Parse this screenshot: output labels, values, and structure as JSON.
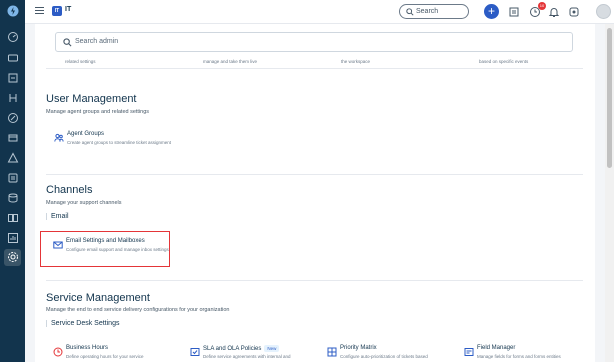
{
  "header": {
    "workspace_badge": "IT",
    "workspace_name": "IT",
    "search_label": "Search",
    "notifications_count": "10"
  },
  "admin_search": {
    "placeholder": "Search admin"
  },
  "prev_row_texts": [
    "related settings",
    "manage and take them live",
    "the workspace",
    "based on specific events"
  ],
  "user_management": {
    "title": "User Management",
    "description": "Manage agent groups and related settings",
    "cards": [
      {
        "title": "Agent Groups",
        "description": "Create agent groups to streamline ticket assignment",
        "icon": "agent-groups-icon"
      }
    ]
  },
  "channels": {
    "title": "Channels",
    "description": "Manage your support channels",
    "subsection": "Email",
    "cards": [
      {
        "title": "Email Settings and Mailboxes",
        "description": "Configure email support and manage inbox settings",
        "icon": "mail-icon"
      }
    ]
  },
  "service_management": {
    "title": "Service Management",
    "description": "Manage the end to end service delivery configurations for your organization",
    "subsection": "Service Desk Settings",
    "cards": [
      {
        "title": "Business Hours",
        "description": "Define operating hours for your service",
        "icon": "clock-icon"
      },
      {
        "title": "SLA and OLA Policies",
        "badge": "New",
        "description": "Define service agreements with internal and",
        "icon": "sla-icon"
      },
      {
        "title": "Priority Matrix",
        "description": "Configure auto-prioritization of tickets based",
        "icon": "matrix-icon"
      },
      {
        "title": "Field Manager",
        "description": "Manage fields for forms and forms entities",
        "icon": "field-manager-icon"
      }
    ]
  },
  "colors": {
    "nav_bg": "#12344d",
    "accent": "#2c5cc5",
    "highlight": "#e43538"
  }
}
